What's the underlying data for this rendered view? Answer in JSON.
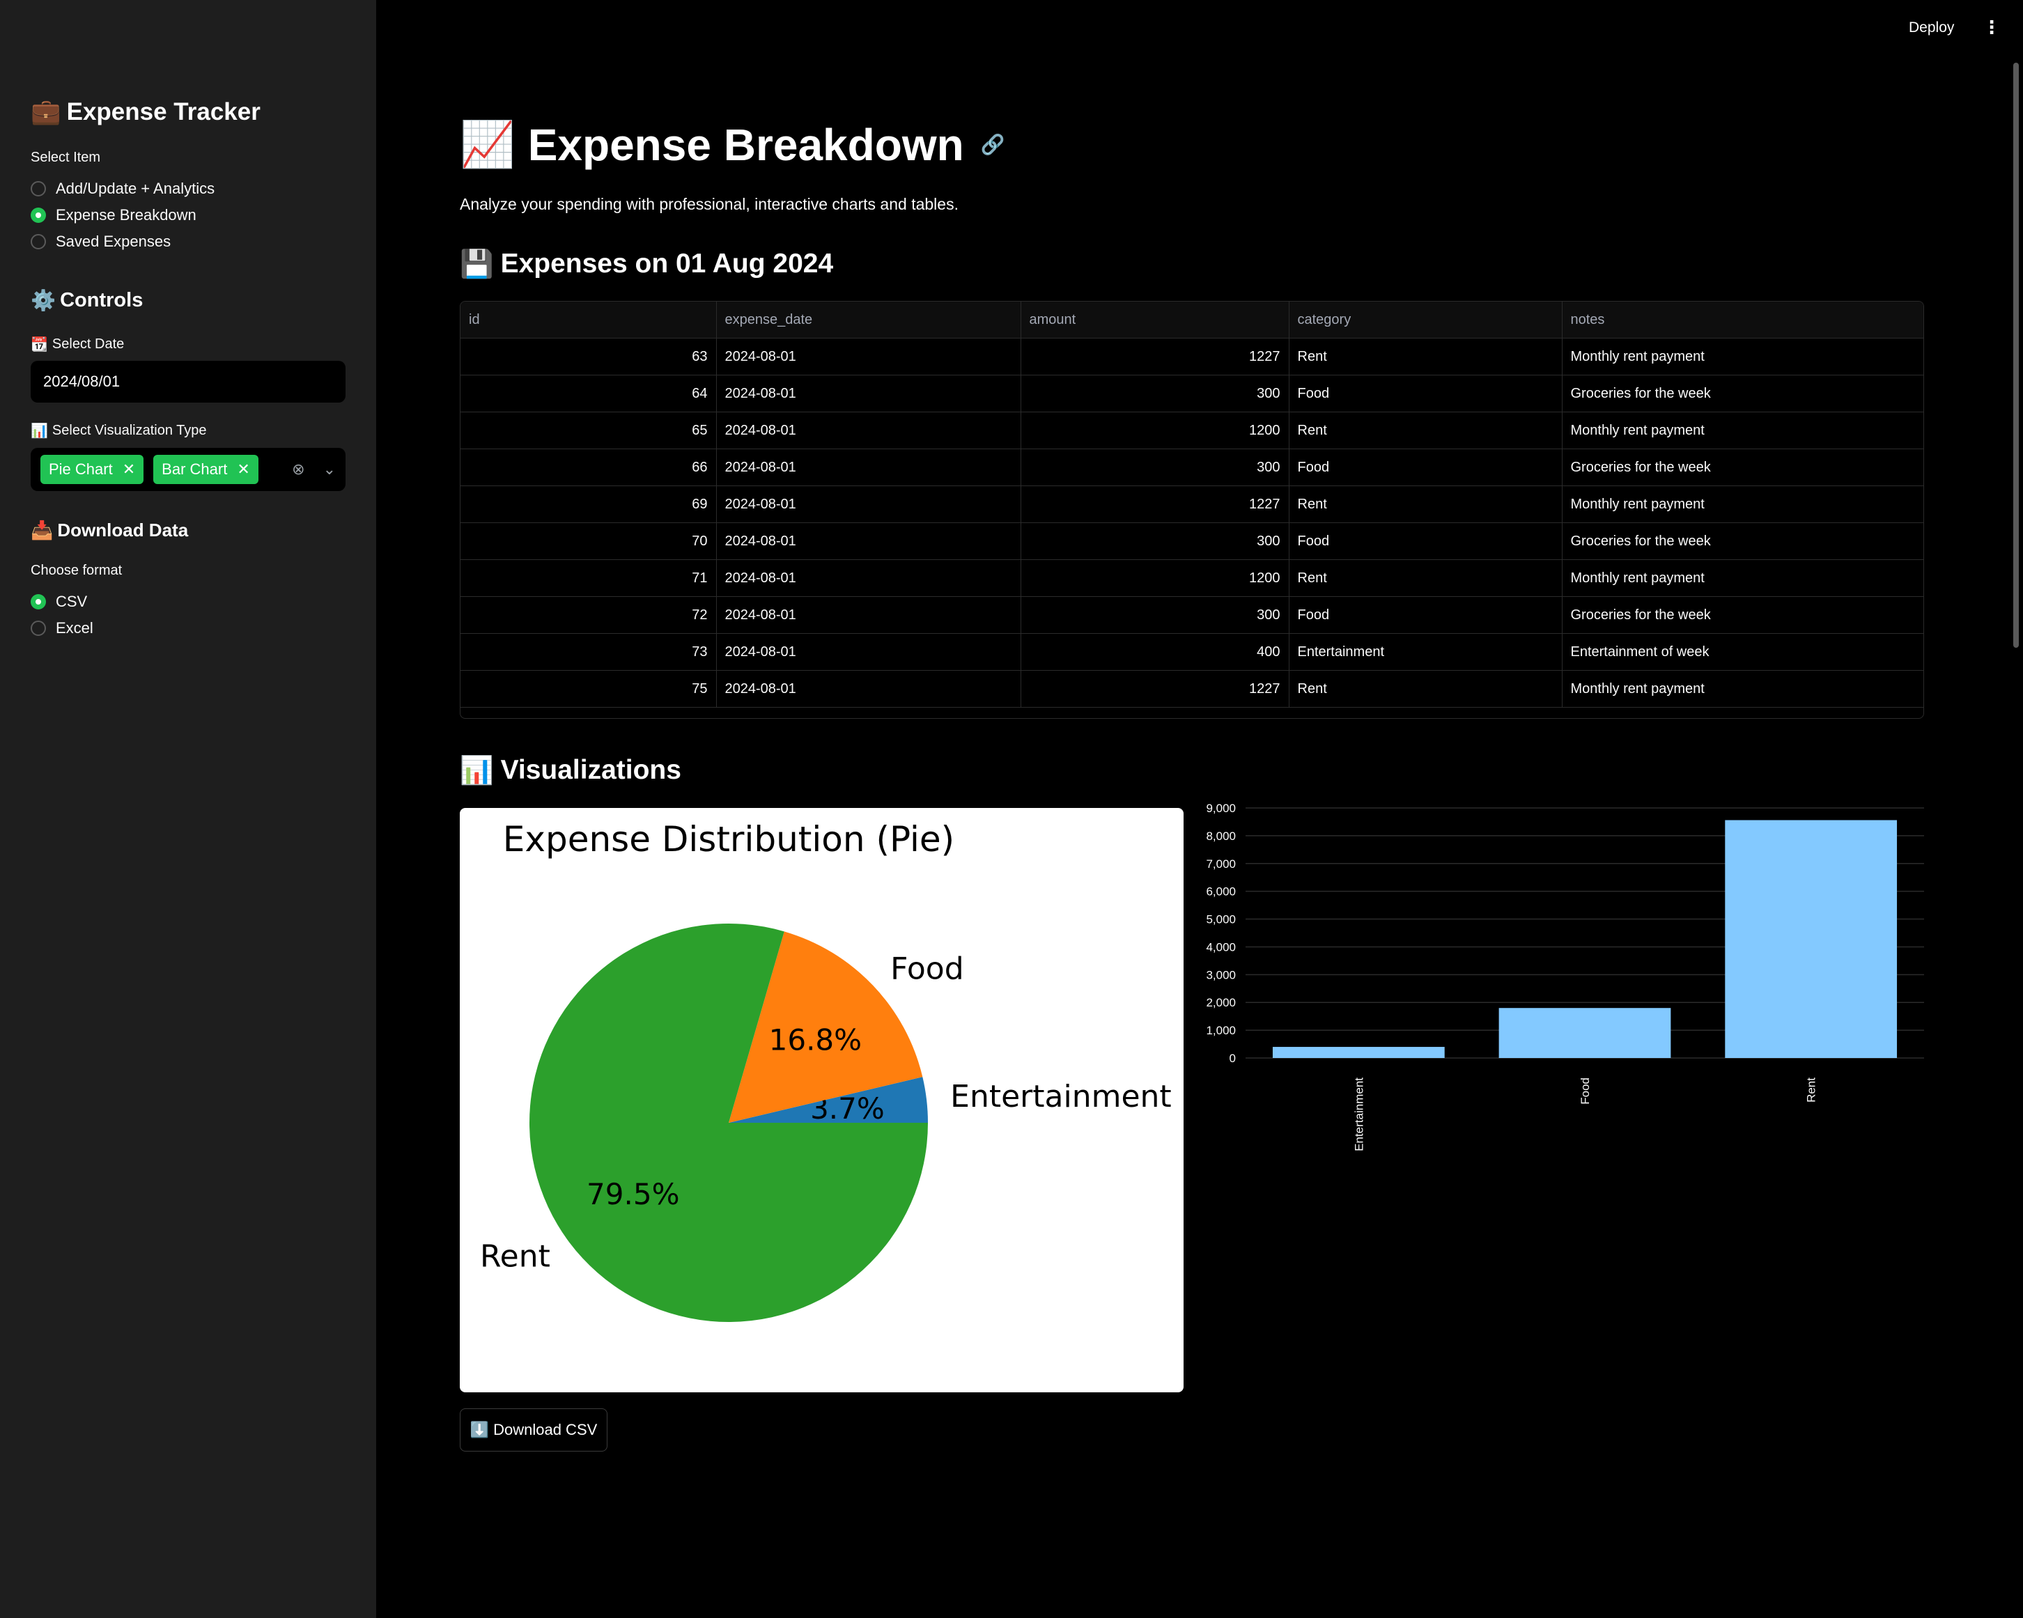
{
  "sidebar": {
    "title": "Expense Tracker",
    "select_item_label": "Select Item",
    "nav_options": [
      {
        "label": "Add/Update + Analytics",
        "selected": false
      },
      {
        "label": "Expense Breakdown",
        "selected": true
      },
      {
        "label": "Saved Expenses",
        "selected": false
      }
    ],
    "controls_heading": "Controls",
    "select_date_label": "Select Date",
    "date_value": "2024/08/01",
    "viz_type_label": "Select Visualization Type",
    "viz_chips": [
      "Pie Chart",
      "Bar Chart"
    ],
    "download_heading": "Download Data",
    "choose_format_label": "Choose format",
    "format_options": [
      {
        "label": "CSV",
        "selected": true
      },
      {
        "label": "Excel",
        "selected": false
      }
    ]
  },
  "header": {
    "deploy_label": "Deploy",
    "menu_icon": "kebab-menu-icon"
  },
  "main": {
    "title": "Expense Breakdown",
    "subtitle": "Analyze your spending with professional, interactive charts and tables.",
    "expenses_heading": "Expenses on 01 Aug 2024",
    "visualizations_heading": "Visualizations",
    "download_button_label": "Download CSV"
  },
  "table": {
    "columns": [
      "id",
      "expense_date",
      "amount",
      "category",
      "notes"
    ],
    "rows": [
      [
        "63",
        "2024-08-01",
        "1227",
        "Rent",
        "Monthly rent payment"
      ],
      [
        "64",
        "2024-08-01",
        "300",
        "Food",
        "Groceries for the week"
      ],
      [
        "65",
        "2024-08-01",
        "1200",
        "Rent",
        "Monthly rent payment"
      ],
      [
        "66",
        "2024-08-01",
        "300",
        "Food",
        "Groceries for the week"
      ],
      [
        "69",
        "2024-08-01",
        "1227",
        "Rent",
        "Monthly rent payment"
      ],
      [
        "70",
        "2024-08-01",
        "300",
        "Food",
        "Groceries for the week"
      ],
      [
        "71",
        "2024-08-01",
        "1200",
        "Rent",
        "Monthly rent payment"
      ],
      [
        "72",
        "2024-08-01",
        "300",
        "Food",
        "Groceries for the week"
      ],
      [
        "73",
        "2024-08-01",
        "400",
        "Entertainment",
        "Entertainment of week"
      ],
      [
        "75",
        "2024-08-01",
        "1227",
        "Rent",
        "Monthly rent payment"
      ]
    ]
  },
  "colors": {
    "accent": "#21c354",
    "sidebar_bg": "#1e1e1e",
    "pie_rent": "#2ca02c",
    "pie_food": "#ff7f0e",
    "pie_entertainment": "#1f77b4",
    "bar_fill": "#83c9ff"
  },
  "chart_data": [
    {
      "type": "pie",
      "title": "Expense Distribution (Pie)",
      "labels": [
        "Entertainment",
        "Food",
        "Rent"
      ],
      "percent_labels": [
        "3.7%",
        "16.8%",
        "79.5%"
      ],
      "values": [
        3.7,
        16.8,
        79.5
      ],
      "colors": [
        "#1f77b4",
        "#ff7f0e",
        "#2ca02c"
      ]
    },
    {
      "type": "bar",
      "categories": [
        "Entertainment",
        "Food",
        "Rent"
      ],
      "values": [
        400,
        1800,
        8562
      ],
      "ylim": [
        0,
        9000
      ],
      "yticks": [
        "0",
        "1,000",
        "2,000",
        "3,000",
        "4,000",
        "5,000",
        "6,000",
        "7,000",
        "8,000",
        "9,000"
      ],
      "grid": true,
      "color": "#83c9ff"
    }
  ]
}
